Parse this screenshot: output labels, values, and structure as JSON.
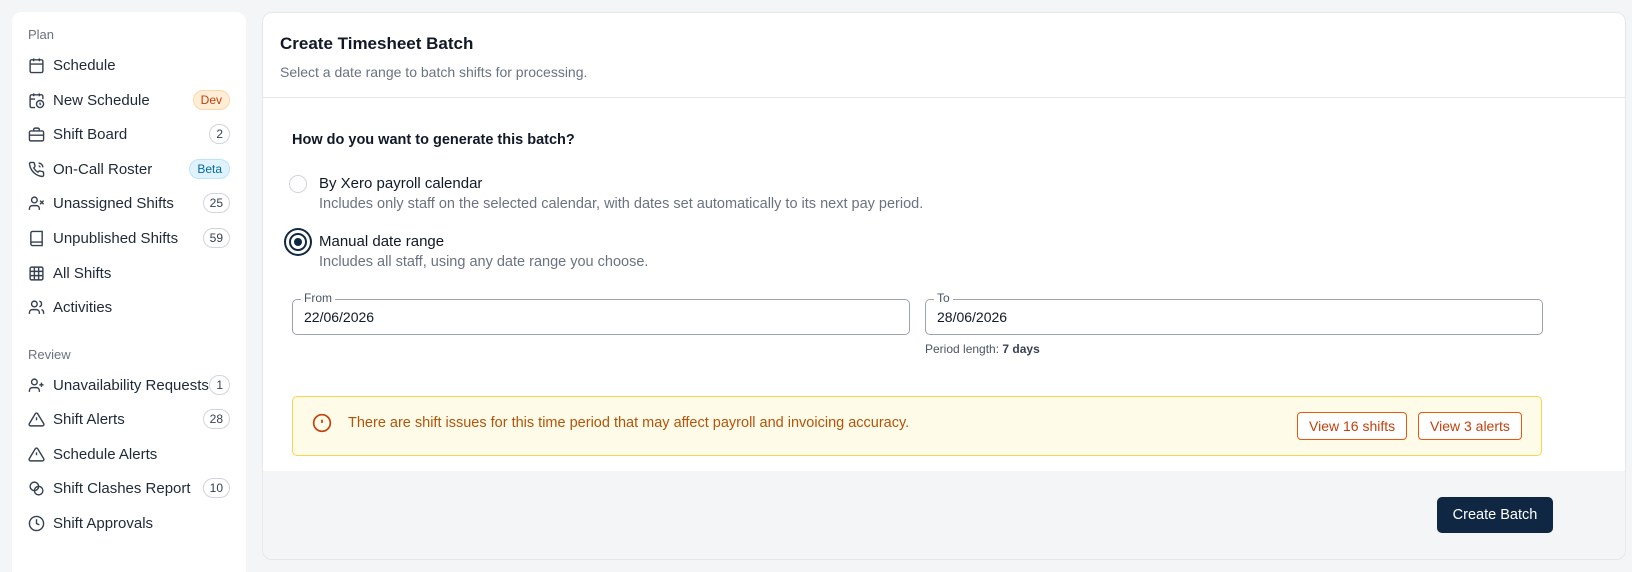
{
  "sidebar": {
    "plan_label": "Plan",
    "review_label": "Review",
    "plan_items": [
      {
        "label": "Schedule",
        "icon": "calendar-icon"
      },
      {
        "label": "New Schedule",
        "icon": "calendar-clock-icon",
        "badge": "Dev"
      },
      {
        "label": "Shift Board",
        "icon": "briefcase-icon",
        "count": "2"
      },
      {
        "label": "On-Call Roster",
        "icon": "phone-icon",
        "badge": "Beta"
      },
      {
        "label": "Unassigned Shifts",
        "icon": "user-x-icon",
        "count": "25"
      },
      {
        "label": "Unpublished Shifts",
        "icon": "book-icon",
        "count": "59"
      },
      {
        "label": "All Shifts",
        "icon": "grid-icon"
      },
      {
        "label": "Activities",
        "icon": "users-icon"
      }
    ],
    "review_items": [
      {
        "label": "Unavailability Requests",
        "icon": "user-plus-icon",
        "count": "1"
      },
      {
        "label": "Shift Alerts",
        "icon": "warning-icon",
        "count": "28"
      },
      {
        "label": "Schedule Alerts",
        "icon": "warning-icon"
      },
      {
        "label": "Shift Clashes Report",
        "icon": "link-icon",
        "count": "10"
      },
      {
        "label": "Shift Approvals",
        "icon": "clock-icon"
      }
    ]
  },
  "panel": {
    "title": "Create Timesheet Batch",
    "subtitle": "Select a date range to batch shifts for processing.",
    "question": "How do you want to generate this batch?",
    "options": [
      {
        "title": "By Xero payroll calendar",
        "description": "Includes only staff on the selected calendar, with dates set automatically to its next pay period.",
        "selected": false
      },
      {
        "title": "Manual date range",
        "description": "Includes all staff, using any date range you choose.",
        "selected": true
      }
    ],
    "from": {
      "label": "From",
      "value": "22/06/2026"
    },
    "to": {
      "label": "To",
      "value": "28/06/2026"
    },
    "period": {
      "label": "Period length:",
      "value": "7 days"
    },
    "alert": {
      "text": "There are shift issues for this time period that may affect payroll and invoicing accuracy.",
      "view_shifts": "View 16 shifts",
      "view_alerts": "View 3 alerts"
    },
    "create_button": "Create Batch"
  },
  "colors": {
    "primary": "#0f2742",
    "alert_bg": "#fefce8",
    "alert_border": "#fcd34d",
    "alert_text": "#b45309"
  }
}
